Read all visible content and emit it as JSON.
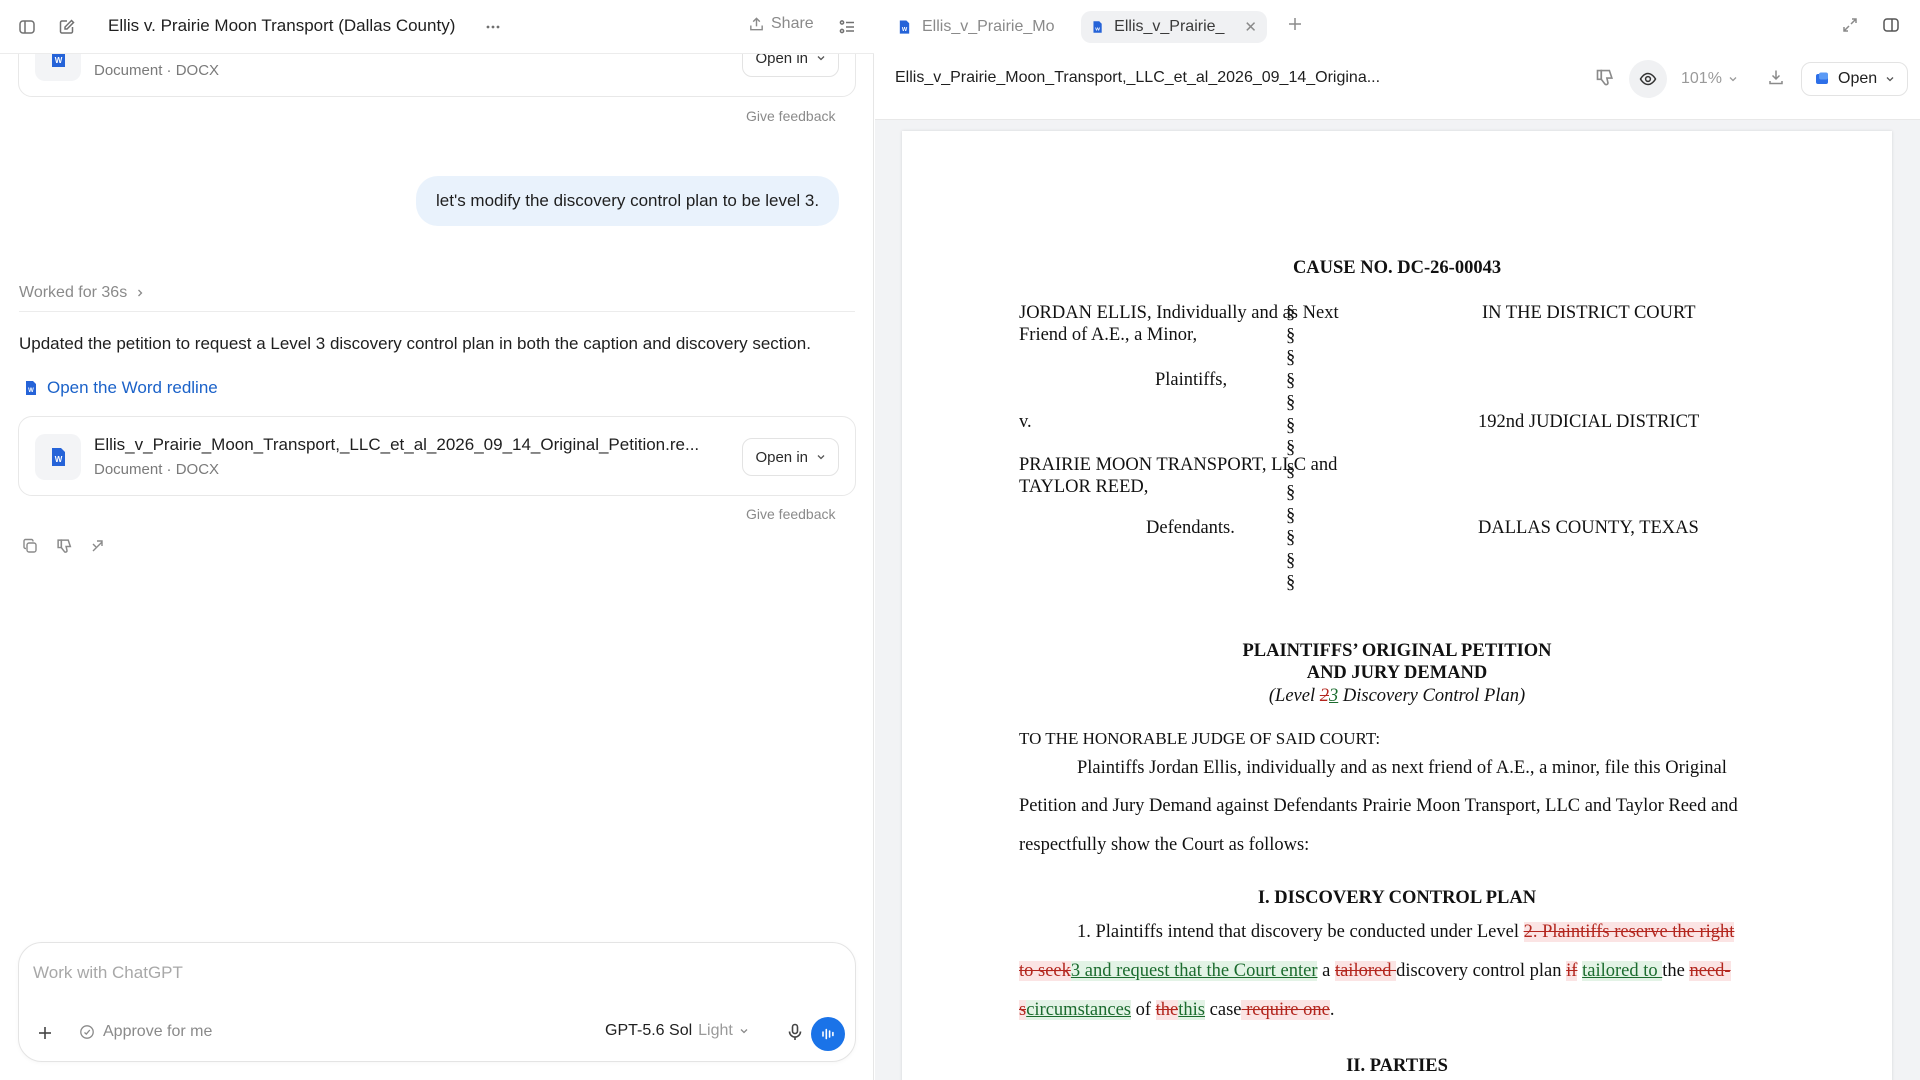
{
  "chat": {
    "title": "Ellis v. Prairie Moon Transport (Dallas County)",
    "share_label": "Share",
    "prior_file": {
      "meta": "Document · DOCX",
      "open_in_label": "Open in",
      "feedback_label": "Give feedback"
    },
    "user_message": "let's modify the discovery control plan to be level 3.",
    "worked_for": "Worked for 36s",
    "assistant_message": "Updated the petition to request a Level 3 discovery control plan in both the caption and discovery section.",
    "redline_link": "Open the Word redline",
    "file": {
      "name": "Ellis_v_Prairie_Moon_Transport,_LLC_et_al_2026_09_14_Original_Petition.re...",
      "meta": "Document · DOCX",
      "open_in_label": "Open in",
      "feedback_label": "Give feedback"
    },
    "composer": {
      "placeholder": "Work with ChatGPT",
      "approve_label": "Approve for me",
      "model_name": "GPT-5.6 Sol",
      "model_mode": "Light"
    }
  },
  "viewer": {
    "tabs": [
      {
        "label": "Ellis_v_Prairie_Mo",
        "active": false
      },
      {
        "label": "Ellis_v_Prairie_",
        "active": true
      }
    ],
    "filename": "Ellis_v_Prairie_Moon_Transport,_LLC_et_al_2026_09_14_Origina...",
    "zoom": "101%",
    "open_label": "Open"
  },
  "document": {
    "cause_no": "CAUSE NO. DC-26-00043",
    "caption_left": {
      "plaintiff_line1": "JORDAN ELLIS, Individually and as Next",
      "plaintiff_line2": "Friend of A.E., a Minor,",
      "plaintiffs": "Plaintiffs,",
      "v": "v.",
      "defendant_line1": "PRAIRIE MOON TRANSPORT, LLC and",
      "defendant_line2": "TAYLOR REED,",
      "defendants": "Defendants."
    },
    "section_mark": "§",
    "caption_right": {
      "court": "IN THE DISTRICT COURT",
      "district": "192nd JUDICIAL DISTRICT",
      "county": "DALLAS COUNTY, TEXAS"
    },
    "petition_title_1": "PLAINTIFFS’ ORIGINAL PETITION",
    "petition_title_2": "AND JURY DEMAND",
    "level_line": {
      "prefix": "(Level ",
      "deleted": "2",
      "inserted": "3",
      "suffix": " Discovery Control Plan)"
    },
    "salutation": "TO THE HONORABLE JUDGE OF SAID COURT:",
    "intro_line1": "Plaintiffs Jordan Ellis, individually and as next friend of A.E., a minor, file this Original",
    "intro_line2": "Petition and Jury Demand against Defendants Prairie Moon Transport, LLC and Taylor Reed and",
    "intro_line3": "respectfully show the Court as follows:",
    "section1_heading": "I. DISCOVERY CONTROL PLAN",
    "para1": {
      "l1_text": "1. Plaintiffs intend that discovery be conducted under Level ",
      "l1_del": "2. Plaintiffs reserve the right",
      "l2_del1": "to seek",
      "l2_ins1": "3 and request that the Court enter",
      "l2_text1": " a ",
      "l2_del2": "tailored ",
      "l2_text2": "discovery control plan ",
      "l2_del3": "if",
      "l2_text3": " ",
      "l2_ins2": "tailored to ",
      "l2_text4": "the ",
      "l2_del4": "need-",
      "l3_del1": "s",
      "l3_ins1": "circumstances",
      "l3_text1": " of ",
      "l3_del2": "the",
      "l3_ins2": "this",
      "l3_text2": " case",
      "l3_del3": " require one",
      "l3_text3": "."
    },
    "section2_heading": "II. PARTIES"
  }
}
